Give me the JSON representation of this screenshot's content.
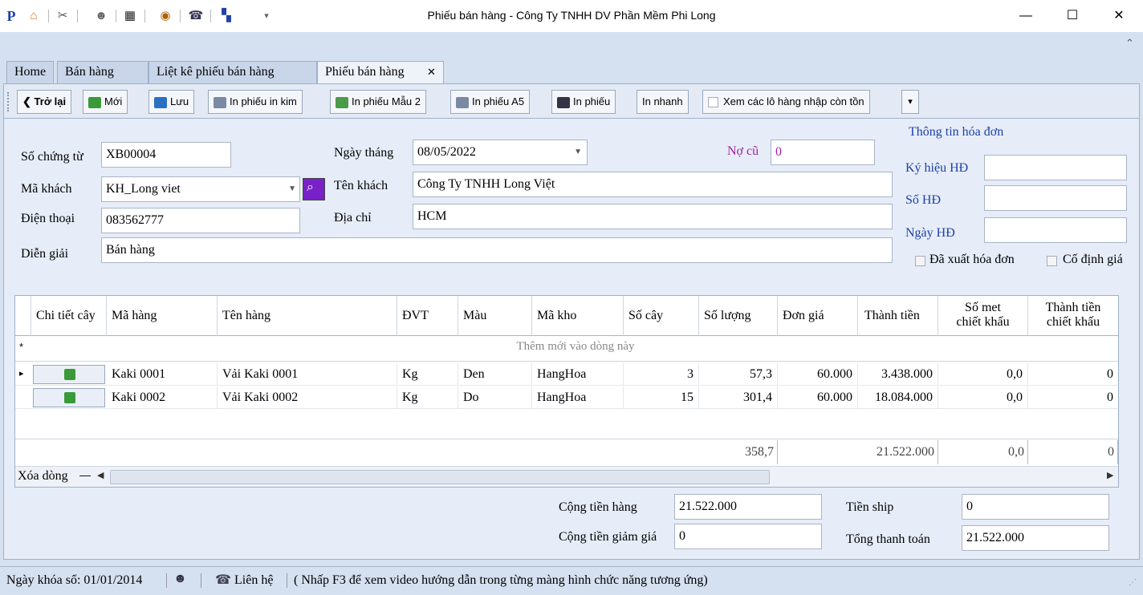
{
  "window": {
    "title": "Phiếu bán hàng - Công Ty TNHH DV Phần Mềm Phi Long",
    "logo": "P",
    "minimize": "—",
    "maximize": "☐",
    "close": "✕",
    "collapse": "⌃"
  },
  "tabs": [
    {
      "label": "Home"
    },
    {
      "label": "Bán hàng"
    },
    {
      "label": "Liệt kê phiếu bán hàng"
    },
    {
      "label": "Phiếu bán hàng",
      "close": "✕"
    }
  ],
  "toolbar": {
    "back": "Trở lại",
    "new": "Mới",
    "save": "Lưu",
    "print_dot": "In phiếu in kim",
    "print_mau2": "In phiếu Mẫu 2",
    "print_a5": "In phiếu A5",
    "print": "In phiếu",
    "print_fast": "In nhanh",
    "show_lots": "Xem các lô hàng nhập còn tồn"
  },
  "form": {
    "so_chung_tu_label": "Số chứng từ",
    "so_chung_tu": "XB00004",
    "ma_khach_label": "Mã khách",
    "ma_khach": "KH_Long viet",
    "dien_thoai_label": "Điện thoại",
    "dien_thoai": "083562777",
    "dien_giai_label": "Diễn giải",
    "dien_giai": "Bán hàng",
    "ngay_thang_label": "Ngày tháng",
    "ngay_thang": "08/05/2022",
    "ten_khach_label": "Tên khách",
    "ten_khach": "Công Ty TNHH Long Việt",
    "dia_chi_label": "Địa chỉ",
    "dia_chi": "HCM",
    "no_cu_label": "Nợ cũ",
    "no_cu": "0"
  },
  "invoice": {
    "title": "Thông tin hóa đơn",
    "ky_hieu_label": "Ký hiệu HĐ",
    "ky_hieu": "",
    "so_hd_label": "Số HĐ",
    "so_hd": "",
    "ngay_hd_label": "Ngày HĐ",
    "ngay_hd": "",
    "da_xuat_label": "Đã xuất hóa đơn",
    "co_dinh_label": "Cố định giá"
  },
  "grid": {
    "headers": [
      "Chi tiết cây",
      "Mã hàng",
      "Tên hàng",
      "ĐVT",
      "Màu",
      "Mã kho",
      "Số cây",
      "Số lượng",
      "Đơn giá",
      "Thành tiền"
    ],
    "h_so_met_1": "Số met",
    "h_so_met_2": "chiết khấu",
    "h_tt_ck_1": "Thành tiền",
    "h_tt_ck_2": "chiết khấu",
    "new_row": "Thêm mới vào dòng này",
    "new_row_marker": "*",
    "current_row_marker": "▸",
    "rows": [
      {
        "ma_hang": "Kaki 0001",
        "ten_hang": "Vải Kaki 0001",
        "dvt": "Kg",
        "mau": "Den",
        "ma_kho": "HangHoa",
        "so_cay": "3",
        "so_luong": "57,3",
        "don_gia": "60.000",
        "thanh_tien": "3.438.000",
        "so_met_ck": "0,0",
        "tt_ck": "0"
      },
      {
        "ma_hang": "Kaki 0002",
        "ten_hang": "Vải Kaki 0002",
        "dvt": "Kg",
        "mau": "Do",
        "ma_kho": "HangHoa",
        "so_cay": "15",
        "so_luong": "301,4",
        "don_gia": "60.000",
        "thanh_tien": "18.084.000",
        "so_met_ck": "0,0",
        "tt_ck": "0"
      }
    ],
    "footer": {
      "so_luong": "358,7",
      "thanh_tien": "21.522.000",
      "so_met_ck": "0,0",
      "tt_ck": "0"
    },
    "delete_row": "Xóa dòng"
  },
  "totals": {
    "cong_tien_hang_label": "Cộng tiền hàng",
    "cong_tien_hang": "21.522.000",
    "cong_tien_giam_gia_label": "Cộng tiền giảm giá",
    "cong_tien_giam_gia": "0",
    "tien_ship_label": "Tiền ship",
    "tien_ship": "0",
    "tong_thanh_toan_label": "Tổng thanh toán",
    "tong_thanh_toan": "21.522.000"
  },
  "status": {
    "lock_date": "Ngày khóa sổ: 01/01/2014",
    "contact": "Liên hệ",
    "hint": "( Nhấp F3 để xem video hướng dẫn trong từng màng hình chức năng tương ứng)"
  },
  "colors": {
    "accent": "#1f3fa8",
    "debt": "#a020a0",
    "panel": "#e6edf8",
    "chrome": "#d5e0f0"
  }
}
